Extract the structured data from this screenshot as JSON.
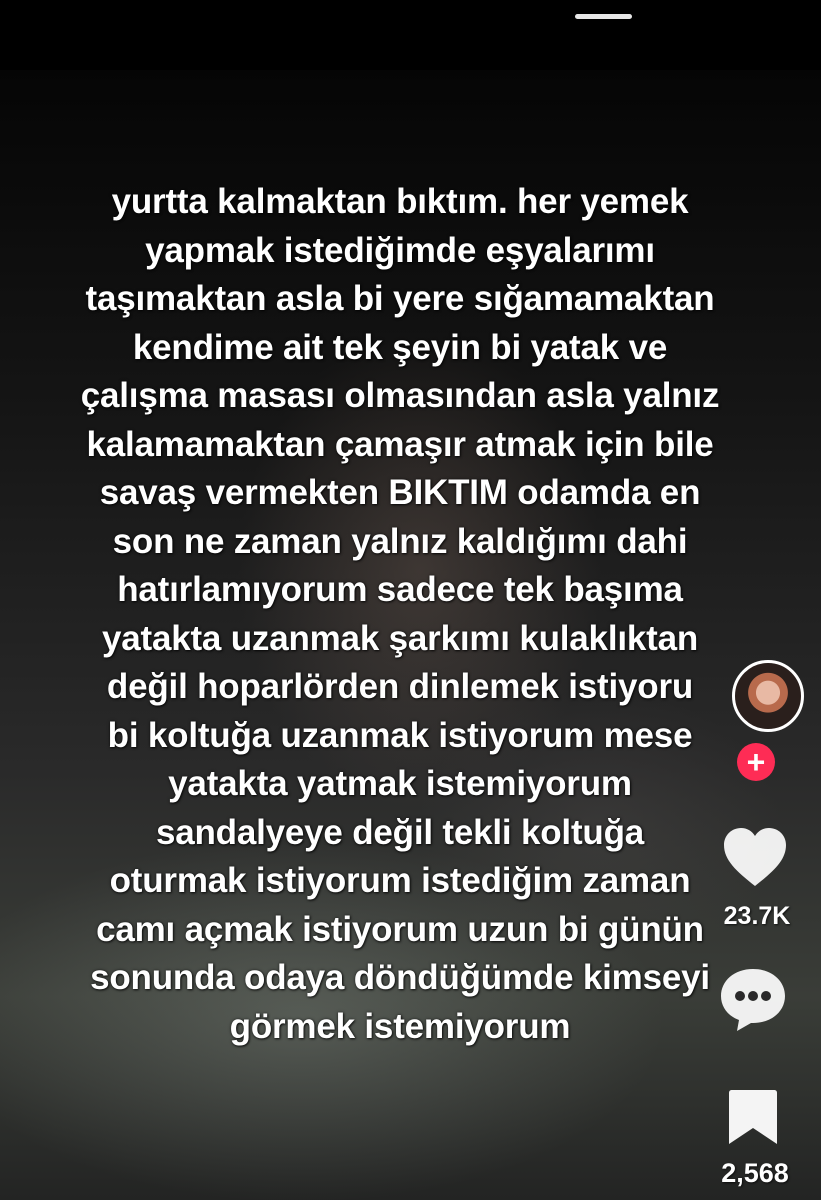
{
  "caption": "yurtta kalmaktan bıktım. her yemek\nyapmak istediğimde eşyalarımı\ntaşımaktan asla bi yere sığamamaktan\nkendime ait tek şeyin bi yatak ve\nçalışma masası olmasından asla yalnız\nkalamamaktan çamaşır atmak için bile\nsavaş vermekten BIKTIM  odamda en\nson ne zaman yalnız kaldığımı dahi\nhatırlamıyorum sadece tek başıma\nyatakta uzanmak şarkımı kulaklıktan\ndeğil hoparlörden dinlemek istiyoru\nbi koltuğa uzanmak istiyorum mese\nyatakta yatmak istemiyorum\nsandalyeye değil tekli koltuğa\noturmak istiyorum istediğim zaman\ncamı açmak istiyorum uzun bi günün\nsonunda odaya döndüğümde kimseyi\ngörmek istemiyorum",
  "actions": {
    "follow_icon_text": "+",
    "like_count": "23.7K",
    "save_count": "2,568"
  },
  "icons": {
    "like": "heart-icon",
    "comment": "comment-bubble-icon",
    "save": "bookmark-icon",
    "follow": "plus-icon",
    "avatar": "creator-avatar"
  },
  "colors": {
    "follow_accent": "#fe2c55",
    "icon": "#ffffff"
  }
}
